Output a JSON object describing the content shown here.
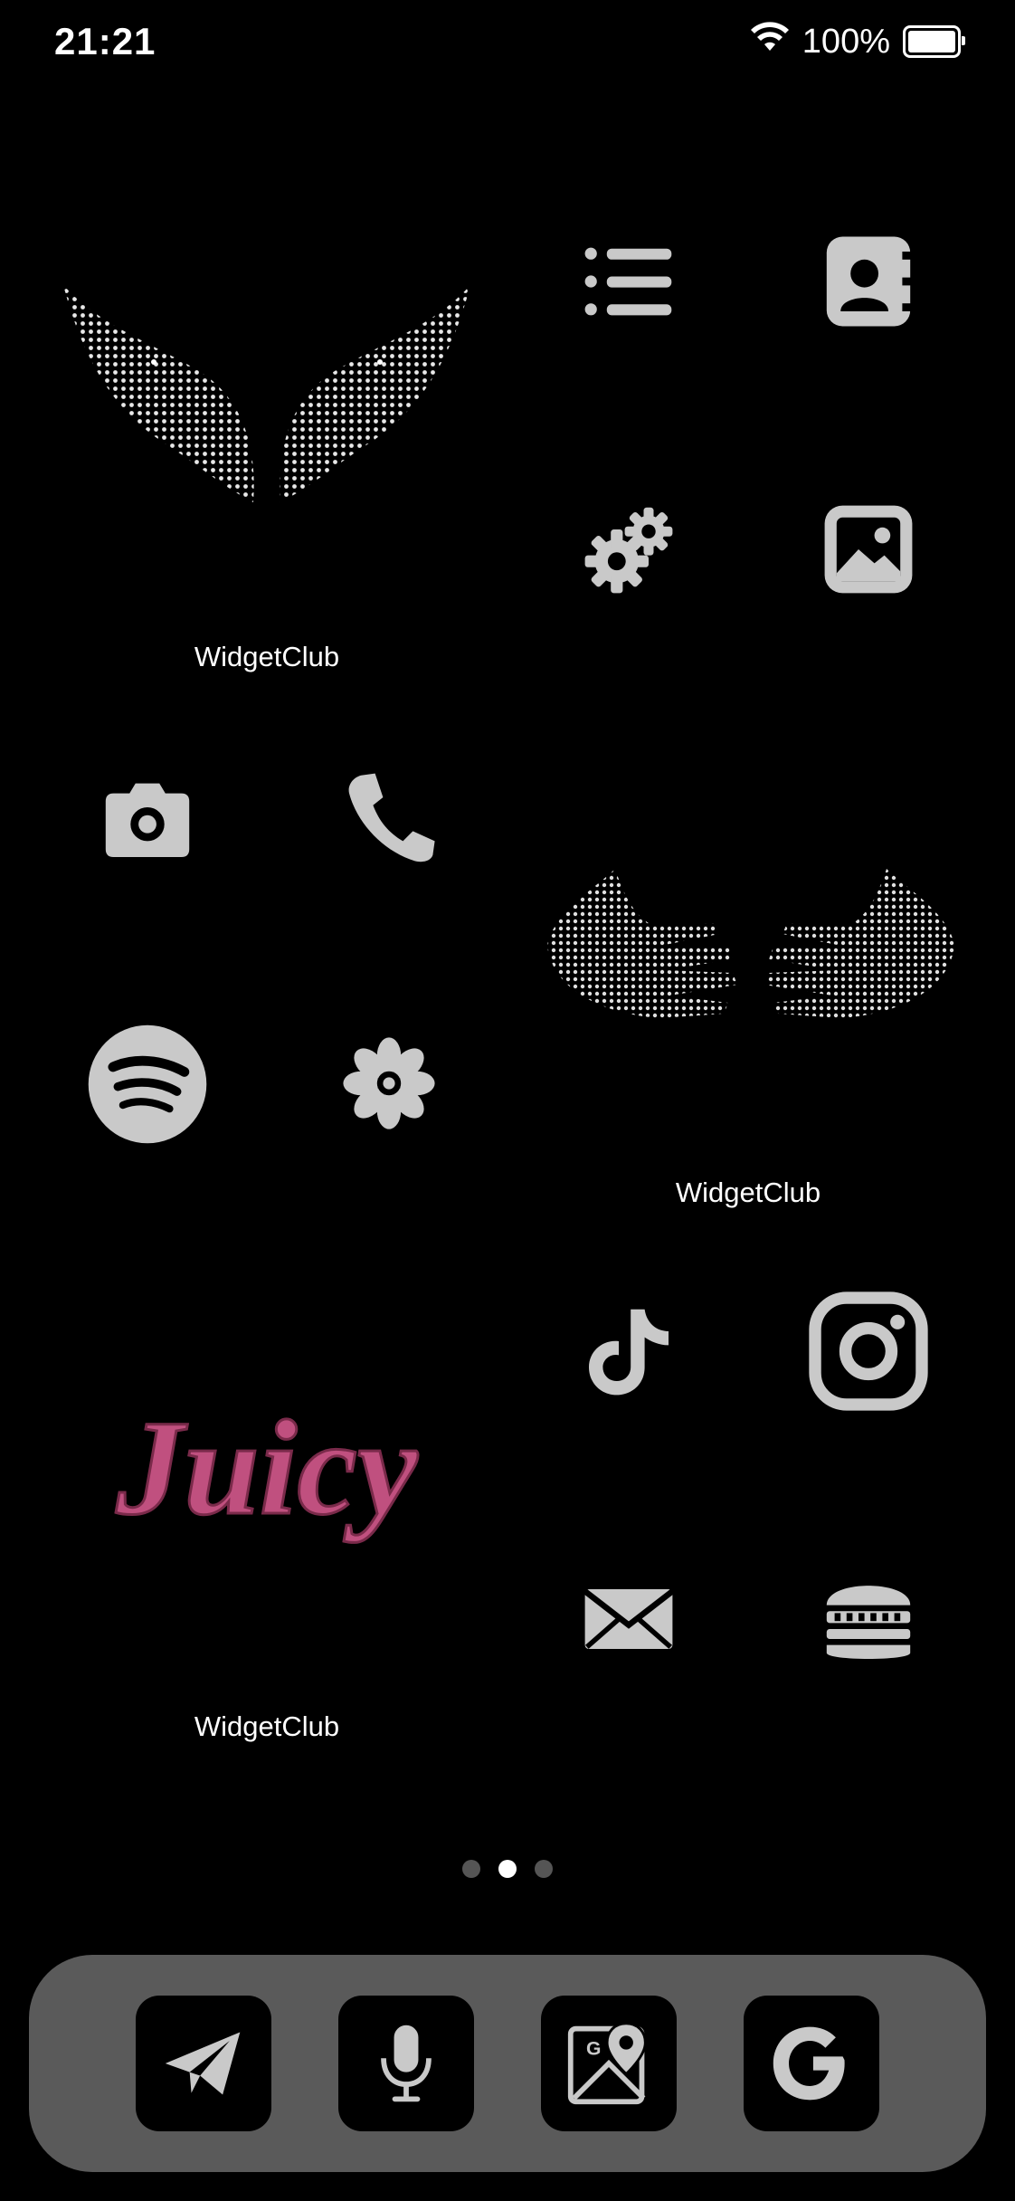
{
  "status_bar": {
    "time": "21:21",
    "battery": "100%"
  },
  "widgets": [
    {
      "label": "WidgetClub",
      "image": "rhinestone-wings"
    },
    {
      "label": "WidgetClub",
      "image": "rhinestone-skeleton-hands"
    },
    {
      "label": "WidgetClub",
      "image": "rhinestone-juicy-logo",
      "logo_text": "Juicy"
    }
  ],
  "apps": [
    {
      "icon": "list-icon"
    },
    {
      "icon": "contacts-icon"
    },
    {
      "icon": "settings-gears-icon"
    },
    {
      "icon": "photos-icon"
    },
    {
      "icon": "camera-icon"
    },
    {
      "icon": "phone-icon"
    },
    {
      "icon": "spotify-icon"
    },
    {
      "icon": "flower-icon"
    },
    {
      "icon": "tiktok-icon"
    },
    {
      "icon": "instagram-icon"
    },
    {
      "icon": "mail-icon"
    },
    {
      "icon": "burger-icon"
    }
  ],
  "page_indicator": {
    "count": 3,
    "active": 2
  },
  "dock": [
    {
      "icon": "telegram-icon"
    },
    {
      "icon": "microphone-icon"
    },
    {
      "icon": "google-maps-icon"
    },
    {
      "icon": "google-icon"
    }
  ],
  "colors": {
    "background": "#000000",
    "icon_glitter": "#c9c9c9",
    "dock": "#5a5a5a",
    "juicy_pink": "#c0507f"
  }
}
